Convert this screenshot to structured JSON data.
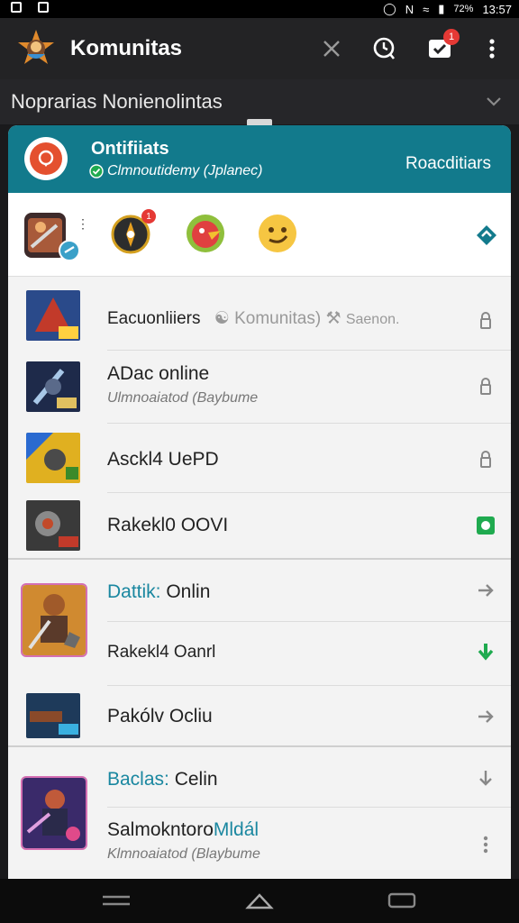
{
  "status_bar": {
    "battery": "72%",
    "time": "13:57",
    "network": "N"
  },
  "app_bar": {
    "title": "Komunitas",
    "notification_count": "1"
  },
  "subheader": {
    "title": "Noprarias Nonienolintas"
  },
  "profile_card": {
    "name": "Ontifiiats",
    "status": "Clmnoutidemy (Jplanec)",
    "action": "Roacditiars",
    "accent": "#127a8c"
  },
  "icon_row": [
    {
      "name": "game-group-icon"
    },
    {
      "name": "compass-badge-icon",
      "badge": "1"
    },
    {
      "name": "red-bird-icon"
    },
    {
      "name": "smiley-icon"
    }
  ],
  "list": [
    {
      "title": "Eacuonliiers",
      "meta1": "Komunitas)",
      "meta2": "Saenon.",
      "action": "lock-icon"
    },
    {
      "title": "ADac online",
      "subtitle": "Ulmnoaiatod (Baybume",
      "action": "lock-icon"
    },
    {
      "title": "Asckl4 UePD",
      "action": "lock-icon"
    },
    {
      "title": "Rakekl0 OOVI",
      "action": "green-square-icon"
    },
    {
      "title_prefix": "Dattik:",
      "title_suffix": " Onlin",
      "action": "arrow-right-icon"
    },
    {
      "title": "Rakekl4 Oanrl",
      "action": "green-download-icon"
    },
    {
      "title": "Pakólv Ocliu",
      "action": "arrow-right-icon"
    },
    {
      "title_prefix": "Baclas:",
      "title_suffix": " Celin",
      "action": "arrow-down-icon"
    },
    {
      "title_prefix": "Salmokntoro",
      "title_suffix": "Mldál",
      "subtitle": "Klmnoaiatod (Blaybume",
      "action": "more-vertical-icon"
    }
  ],
  "colors": {
    "brand_teal": "#127a8c",
    "link_blue": "#1a87a0",
    "green": "#1faa4f",
    "badge_red": "#e53935"
  }
}
